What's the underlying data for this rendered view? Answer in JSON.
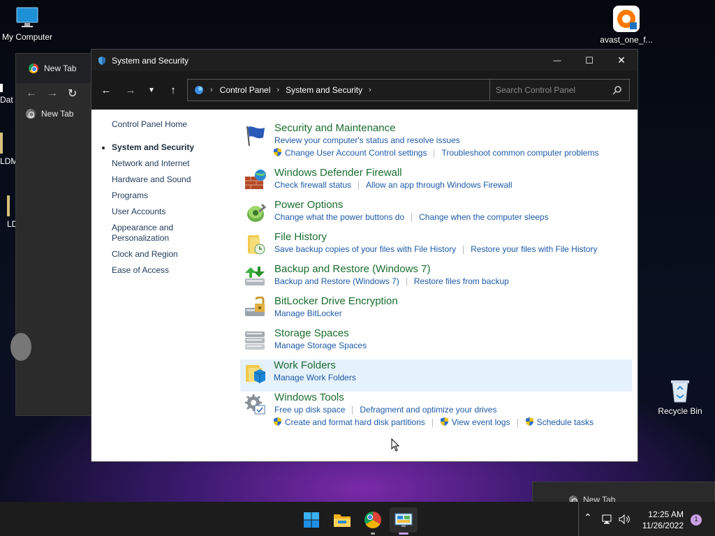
{
  "desktop": {
    "icons": [
      {
        "label": "My Computer",
        "icon": "monitor-icon"
      },
      {
        "label": "avast_one_f...",
        "icon": "avast-icon"
      },
      {
        "label": "Recycle Bin",
        "icon": "recycle-bin-icon"
      }
    ],
    "left_labels": [
      "Dat",
      "LDM",
      "LD"
    ]
  },
  "bg_chrome": {
    "tab_label": "New Tab",
    "tab2_label": "New Tab"
  },
  "window": {
    "title": "System and Security",
    "controls": {
      "minimize": "—",
      "maximize": "☐",
      "close": "✕"
    }
  },
  "address": {
    "crumbs": [
      "Control Panel",
      "System and Security"
    ],
    "search_placeholder": "Search Control Panel"
  },
  "sidebar": {
    "items": [
      "Control Panel Home",
      "System and Security",
      "Network and Internet",
      "Hardware and Sound",
      "Programs",
      "User Accounts",
      "Appearance and Personalization",
      "Clock and Region",
      "Ease of Access"
    ]
  },
  "categories": [
    {
      "title": "Security and Maintenance",
      "links": [
        "Review your computer's status and resolve issues"
      ],
      "links2": [
        "Change User Account Control settings",
        "Troubleshoot common computer problems"
      ]
    },
    {
      "title": "Windows Defender Firewall",
      "links": [
        "Check firewall status",
        "Allow an app through Windows Firewall"
      ]
    },
    {
      "title": "Power Options",
      "links": [
        "Change what the power buttons do",
        "Change when the computer sleeps"
      ]
    },
    {
      "title": "File History",
      "links": [
        "Save backup copies of your files with File History",
        "Restore your files with File History"
      ]
    },
    {
      "title": "Backup and Restore (Windows 7)",
      "links": [
        "Backup and Restore (Windows 7)",
        "Restore files from backup"
      ]
    },
    {
      "title": "BitLocker Drive Encryption",
      "links": [
        "Manage BitLocker"
      ]
    },
    {
      "title": "Storage Spaces",
      "links": [
        "Manage Storage Spaces"
      ]
    },
    {
      "title": "Work Folders",
      "links": [
        "Manage Work Folders"
      ]
    },
    {
      "title": "Windows Tools",
      "links": [
        "Free up disk space",
        "Defragment and optimize your drives"
      ],
      "links2": [
        "Create and format hard disk partitions",
        "View event logs",
        "Schedule tasks"
      ]
    }
  ],
  "taskbar": {
    "apps": [
      "start-icon",
      "file-explorer-icon",
      "chrome-icon",
      "control-panel-icon"
    ],
    "time": "12:25 AM",
    "date": "11/26/2022",
    "notification_count": "1",
    "preview_label": "New Tab"
  }
}
